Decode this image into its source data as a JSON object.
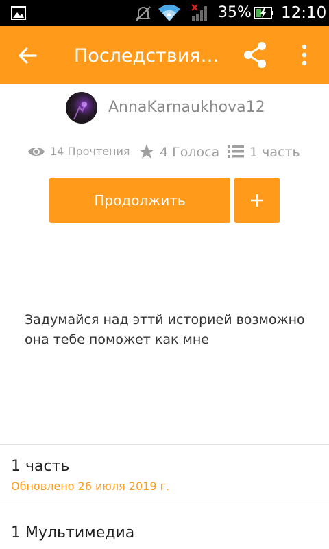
{
  "status_bar": {
    "battery_percent": "35%",
    "time": "12:10",
    "icons": [
      "gallery-icon",
      "mute-icon",
      "wifi-icon",
      "signal-icon",
      "battery-charging-icon"
    ]
  },
  "app_bar": {
    "title": "Последствия ...",
    "icons": [
      "back-arrow-icon",
      "share-icon",
      "more-vert-icon"
    ],
    "color": "#ff9a1a"
  },
  "author": {
    "name": "AnnaKarnaukhova12"
  },
  "stats": {
    "reads": "14 Прочтения",
    "votes": "4 Голоса",
    "parts": "1 часть"
  },
  "actions": {
    "continue_label": "Продолжить",
    "add_label": "+"
  },
  "description": "Задумайся над эттй историей возможно она тебе поможет как мне",
  "parts_list": [
    {
      "title": "1 часть",
      "updated": "Обновлено 26 июля 2019 г."
    }
  ],
  "media": {
    "title": "1 Мультимедиа"
  }
}
